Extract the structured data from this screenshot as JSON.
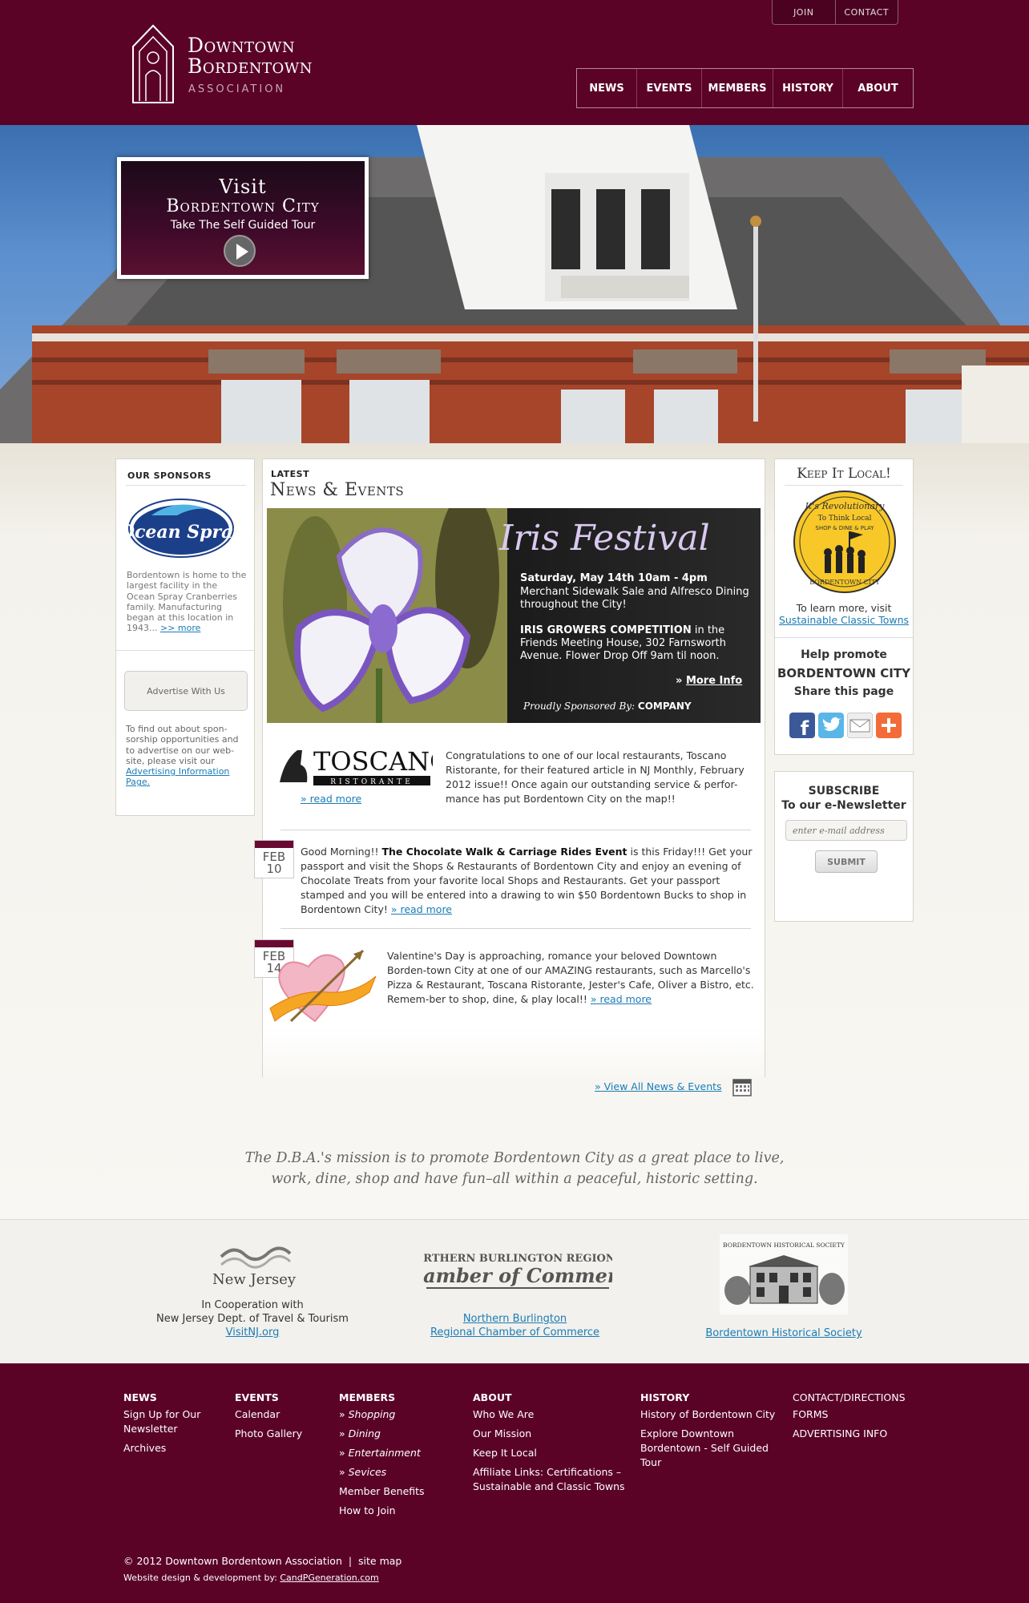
{
  "header": {
    "logo": {
      "line1": "Downtown",
      "line2": "Bordentown",
      "line3": "ASSOCIATION"
    },
    "top_buttons": [
      "JOIN",
      "CONTACT"
    ],
    "nav": [
      "NEWS",
      "EVENTS",
      "MEMBERS",
      "HISTORY",
      "ABOUT"
    ]
  },
  "hero": {
    "line1": "Visit",
    "line2": "Bordentown City",
    "line3": "Take The Self Guided Tour"
  },
  "sponsors": {
    "heading": "OUR SPONSORS",
    "logo_text": "Ocean Spray",
    "description": "Bordentown is home to the largest facility in the Ocean Spray Cranberries family. Manufacturing began at this location in 1943...",
    "more_link": ">> more",
    "advertise_button": "Advertise With Us",
    "advertise_text": "To find out about spon-sorship opportunities and to advertise on our web-site, please visit our",
    "advertise_link": "Advertising Information Page."
  },
  "news": {
    "label": "LATEST",
    "title": "News & Events",
    "iris": {
      "title": "Iris Festival",
      "date": "Saturday, May 14th 10am - 4pm",
      "desc1": "Merchant Sidewalk Sale and Alfresco Dining throughout the City!",
      "desc2_bold": "IRIS GROWERS COMPETITION",
      "desc2": " in the Friends Meeting House, 302 Farnsworth Avenue. Flower Drop Off 9am til noon.",
      "more_info": "More Info",
      "sponsored_by": "Proudly Sponsored By:",
      "sponsor": "COMPANY"
    },
    "toscano": {
      "logo": "TOSCANO",
      "logo_sub": "RISTORANTE",
      "text": "Congratulations to one of our local restaurants, Toscano Ristorante, for their featured article in NJ Monthly, February 2012 issue!! Once again our outstanding service & perfor-mance has put Bordentown City on the map!!",
      "link": "read more"
    },
    "choc": {
      "month": "FEB",
      "day": "10",
      "pre": "Good Morning!! ",
      "bold": "The Chocolate Walk & Carriage Rides Event",
      "text": " is this Friday!!! Get your passport and visit the Shops & Restaurants of Bordentown City and enjoy an evening of Chocolate Treats from your favorite local Shops and Restaurants. Get your passport stamped and you will be entered into a drawing to win $50 Bordentown Bucks to shop in Bordentown City!",
      "link": "read more"
    },
    "valentine": {
      "month": "FEB",
      "day": "14",
      "text": "Valentine's Day is approaching, romance your beloved Downtown Borden-town City at one of our AMAZING restaurants, such as Marcello's Pizza & Restaurant, Toscana Ristorante, Jester's Cafe, Oliver a Bistro, etc. Remem-ber to shop, dine, & play local!!",
      "link": "read more"
    },
    "view_all": "View All News & Events",
    "raquo": "»"
  },
  "keep_local": {
    "heading": "Keep It Local!",
    "badge_top": "It's Revolutionary",
    "badge_mid": "To Think Local",
    "badge_sub": "SHOP & DINE & PLAY",
    "badge_bottom": "BORDENTOWN CITY",
    "learn": "To learn more, visit",
    "learn_link": "Sustainable Classic Towns",
    "help": "Help promote",
    "city": "BORDENTOWN CITY",
    "share": "Share this page"
  },
  "subscribe": {
    "line1": "SUBSCRIBE",
    "line2": "To our e-Newsletter",
    "placeholder": "enter e-mail address",
    "button": "SUBMIT"
  },
  "mission": {
    "line1": "The D.B.A.'s mission is to promote Bordentown City as a great place to live,",
    "line2": "work, dine, shop and have fun–all within a peaceful, historic setting."
  },
  "partners": {
    "nj_logo": "New Jersey",
    "nj_line1": "In Cooperation with",
    "nj_line2": "New Jersey Dept. of Travel & Tourism",
    "nj_link": "VisitNJ.org",
    "chamber_logo1": "NORTHERN BURLINGTON REGIONAL",
    "chamber_logo2": "Chamber of Commerce",
    "chamber_link1": "Northern Burlington",
    "chamber_link2": "Regional Chamber of Commerce",
    "hist_logo": "BORDENTOWN HISTORICAL SOCIETY",
    "hist_link": "Bordentown Historical Society"
  },
  "footer": {
    "news": {
      "heading": "NEWS",
      "items": [
        "Sign Up for Our Newsletter",
        "Archives"
      ]
    },
    "events": {
      "heading": "EVENTS",
      "items": [
        "Calendar",
        "Photo Gallery"
      ]
    },
    "members": {
      "heading": "MEMBERS",
      "items": [
        "Shopping",
        "Dining",
        "Entertainment",
        "Sevices",
        "Member Benefits",
        "How to Join"
      ]
    },
    "about": {
      "heading": "ABOUT",
      "items": [
        "Who We Are",
        "Our Mission",
        "Keep It Local",
        "Affiliate Links: Certifications – Sustainable and Classic Towns"
      ]
    },
    "history": {
      "heading": "HISTORY",
      "items": [
        "History of Bordentown City",
        "Explore Downtown Bordentown - Self Guided Tour"
      ]
    },
    "contact": {
      "items": [
        "CONTACT/DIRECTIONS",
        "FORMS",
        "ADVERTISING INFO"
      ]
    },
    "copyright": "© 2012 Downtown Bordentown Association",
    "sep": "|",
    "sitemap": "site map",
    "credit": "Website design & development by:",
    "credit_link": "CandPGeneration.com"
  },
  "colors": {
    "brand": "#5a0327",
    "link": "#1a7cb5",
    "iris_title": "#d9c9f0"
  }
}
